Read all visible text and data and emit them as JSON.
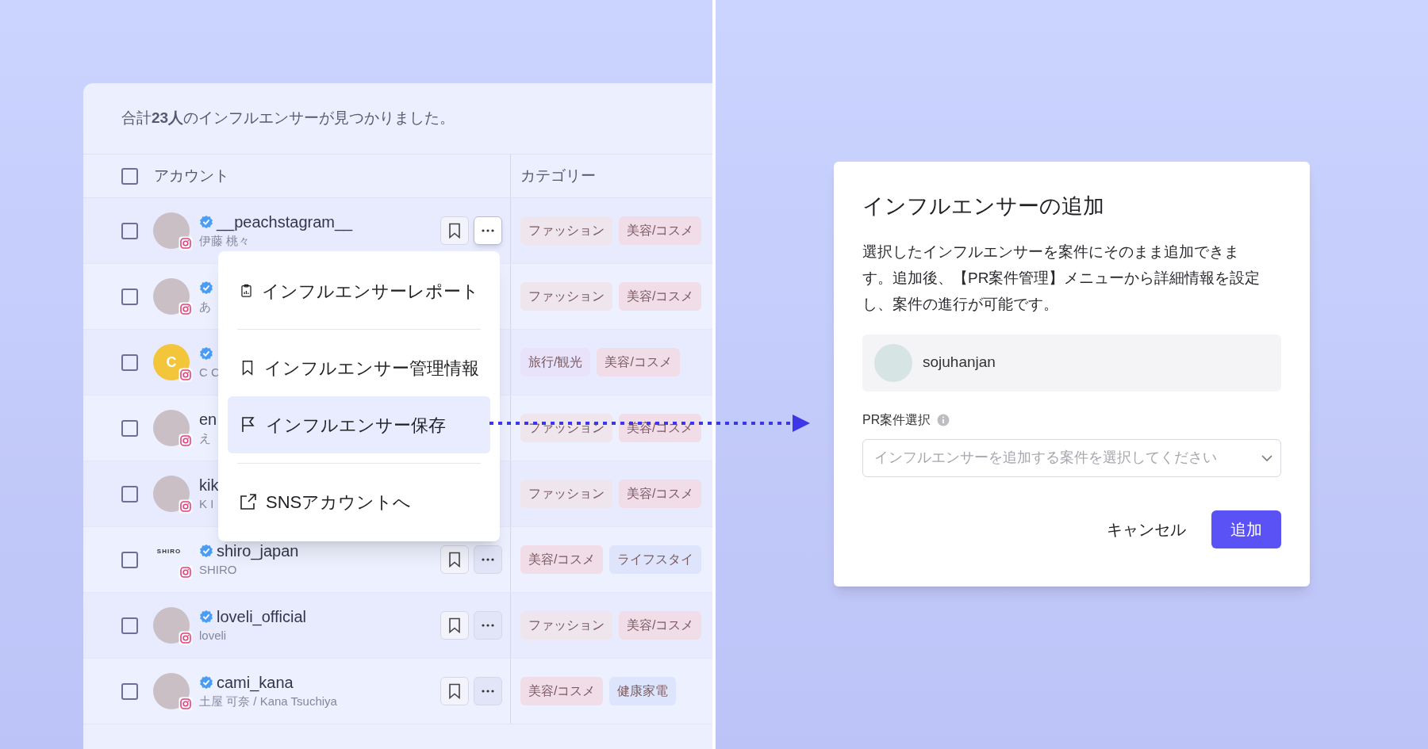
{
  "results": {
    "summary": "合計**23人**のインフルエンサーが見つかりました。",
    "header_checked": false,
    "columns": [
      "アカウント",
      "カテゴリー"
    ],
    "rows": [
      {
        "name": "__peachstagram__",
        "subname": "伊藤 桃々",
        "verified": true,
        "checked": false,
        "actions": true,
        "menu_open": true,
        "tags": [
          {
            "label": "ファッション",
            "color": "#efe5ec"
          },
          {
            "label": "美容/コスメ",
            "color": "#f1dde8"
          }
        ]
      },
      {
        "name": "",
        "subname": "あ",
        "verified": true,
        "checked": false,
        "actions": false,
        "tags": [
          {
            "label": "ファッション",
            "color": "#efe5ec"
          },
          {
            "label": "美容/コスメ",
            "color": "#f1dde8"
          }
        ]
      },
      {
        "name": "",
        "subname": "C C",
        "avatar_text": "C",
        "verified": true,
        "checked": false,
        "actions": false,
        "tags": [
          {
            "label": "旅行/観光",
            "color": "#e8e2fb"
          },
          {
            "label": "美容/コスメ",
            "color": "#f1dde8"
          }
        ]
      },
      {
        "name": "en",
        "subname": "え",
        "verified": false,
        "checked": false,
        "actions": false,
        "tags": [
          {
            "label": "ファッション",
            "color": "#efe5ec"
          },
          {
            "label": "美容/コスメ",
            "color": "#f1dde8"
          }
        ]
      },
      {
        "name": "kik",
        "subname": "K I",
        "verified": false,
        "checked": false,
        "actions": false,
        "tags": [
          {
            "label": "ファッション",
            "color": "#efe5ec"
          },
          {
            "label": "美容/コスメ",
            "color": "#f1dde8"
          }
        ]
      },
      {
        "name": "shiro_japan",
        "subname": "SHIRO",
        "avatar_text": "SHIRO",
        "verified": true,
        "checked": false,
        "actions": true,
        "menu_open": false,
        "tags": [
          {
            "label": "美容/コスメ",
            "color": "#f1dde8"
          },
          {
            "label": "ライフスタイ",
            "color": "#dde4fb"
          }
        ]
      },
      {
        "name": "loveli_official",
        "subname": "loveli",
        "verified": true,
        "checked": false,
        "actions": true,
        "menu_open": false,
        "tags": [
          {
            "label": "ファッション",
            "color": "#efe5ec"
          },
          {
            "label": "美容/コスメ",
            "color": "#f1dde8"
          }
        ]
      },
      {
        "name": "cami_kana",
        "subname": "土屋 可奈 / Kana Tsuchiya",
        "verified": true,
        "checked": false,
        "actions": true,
        "menu_open": false,
        "tags": [
          {
            "label": "美容/コスメ",
            "color": "#f1dde8"
          },
          {
            "label": "健康家電",
            "color": "#dce5fb"
          }
        ]
      }
    ]
  },
  "menu": {
    "items": [
      {
        "kind": "report",
        "label": "インフルエンサーレポート",
        "selected": false
      },
      {
        "kind": "bookmark",
        "label": "インフルエンサー管理情報",
        "selected": false
      },
      {
        "kind": "flag",
        "label": "インフルエンサー保存",
        "selected": true
      },
      {
        "kind": "link",
        "label": "SNSアカウントへ",
        "selected": false
      }
    ]
  },
  "dialog": {
    "title": "インフルエンサーの追加",
    "body": "選択したインフルエンサーを案件にそのまま追加できます。追加後、【PR案件管理】メニューから詳細情報を設定し、案件の進行が可能です。",
    "account": "sojuhanjan",
    "field_label": "PR案件選択",
    "placeholder": "インフルエンサーを追加する案件を選択してください",
    "buttons": [
      {
        "kind": "secondary",
        "label": "キャンセル"
      },
      {
        "kind": "primary",
        "label": "追加"
      }
    ]
  }
}
